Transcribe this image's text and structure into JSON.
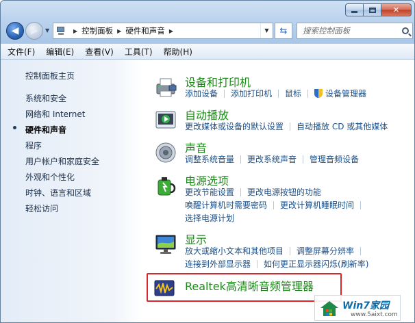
{
  "address": {
    "crumbs": [
      "控制面板",
      "硬件和声音"
    ]
  },
  "search": {
    "placeholder": "搜索控制面板"
  },
  "menu": [
    "文件(F)",
    "编辑(E)",
    "查看(V)",
    "工具(T)",
    "帮助(H)"
  ],
  "sidebar": {
    "items": [
      {
        "label": "控制面板主页"
      },
      {
        "label": "系统和安全"
      },
      {
        "label": "网络和 Internet"
      },
      {
        "label": "硬件和声音",
        "active": true
      },
      {
        "label": "程序"
      },
      {
        "label": "用户帐户和家庭安全"
      },
      {
        "label": "外观和个性化"
      },
      {
        "label": "时钟、语言和区域"
      },
      {
        "label": "轻松访问"
      }
    ]
  },
  "categories": [
    {
      "title": "设备和打印机",
      "icon": "printer-icon",
      "rows": [
        [
          "添加设备",
          "添加打印机",
          "鼠标",
          "设备管理器"
        ]
      ]
    },
    {
      "title": "自动播放",
      "icon": "autoplay-icon",
      "rows": [
        [
          "更改媒体或设备的默认设置",
          "自动播放 CD 或其他媒体"
        ]
      ]
    },
    {
      "title": "声音",
      "icon": "speaker-icon",
      "rows": [
        [
          "调整系统音量",
          "更改系统声音",
          "管理音频设备"
        ]
      ]
    },
    {
      "title": "电源选项",
      "icon": "power-options-icon",
      "rows": [
        [
          "更改节能设置",
          "更改电源按钮的功能"
        ],
        [
          "唤醒计算机时需要密码",
          "更改计算机睡眠时间"
        ],
        [
          "选择电源计划"
        ]
      ]
    },
    {
      "title": "显示",
      "icon": "display-icon",
      "rows": [
        [
          "放大或缩小文本和其他项目",
          "调整屏幕分辨率"
        ],
        [
          "连接到外部显示器",
          "如何更正显示器闪烁(刷新率)"
        ]
      ]
    }
  ],
  "realtek": {
    "title": "Realtek高清晰音频管理器"
  },
  "watermark": {
    "brand": "Win7家园",
    "url": "www.5aixt.com"
  },
  "colors": {
    "link": "#1a4f8a",
    "category_title": "#1d8a1a",
    "highlight": "#d8262a"
  }
}
